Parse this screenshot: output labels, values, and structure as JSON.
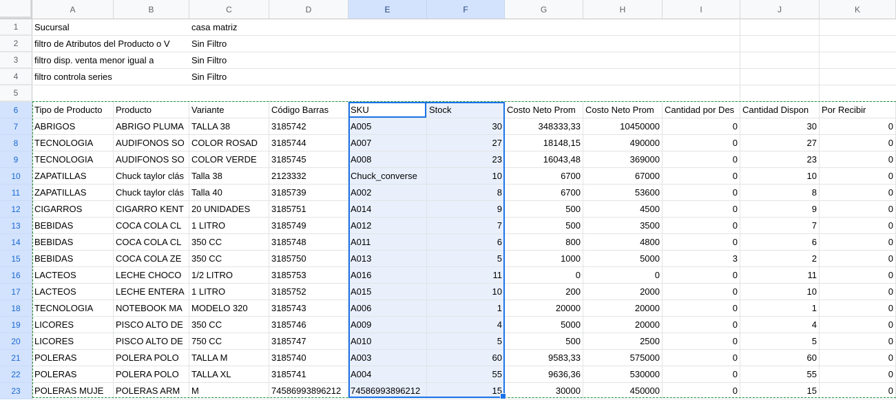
{
  "sheet": {
    "column_headers": [
      "A",
      "B",
      "C",
      "D",
      "E",
      "F",
      "G",
      "H",
      "I",
      "J",
      "K"
    ],
    "selected_columns": [
      "E",
      "F"
    ],
    "selection": {
      "range": "E6:F23",
      "active_cell": "E6"
    },
    "report_rows": [
      {
        "n": "1",
        "a": "Sucursal",
        "c": "casa matriz"
      },
      {
        "n": "2",
        "a": "filtro de Atributos del Producto o V",
        "c": "Sin Filtro"
      },
      {
        "n": "3",
        "a": "filtro disp. venta menor igual a",
        "c": "Sin Filtro"
      },
      {
        "n": "4",
        "a": "filtro controla series",
        "c": "Sin Filtro"
      },
      {
        "n": "5",
        "a": "",
        "c": ""
      }
    ],
    "table": {
      "header_row_number": "6",
      "headers": [
        "Tipo de Producto",
        "Producto",
        "Variante",
        "Código Barras",
        "SKU",
        "Stock",
        "Costo Neto Prom",
        "Costo Neto Prom",
        "Cantidad por Des",
        "Cantidad Dispon",
        "Por Recibir"
      ],
      "rows": [
        {
          "n": "7",
          "cells": [
            "ABRIGOS",
            "ABRIGO PLUMA",
            "TALLA 38",
            "3185742",
            "A005",
            "30",
            "348333,33",
            "10450000",
            "0",
            "30",
            "0"
          ]
        },
        {
          "n": "8",
          "cells": [
            "TECNOLOGIA",
            "AUDIFONOS SO",
            "COLOR ROSAD",
            "3185744",
            "A007",
            "27",
            "18148,15",
            "490000",
            "0",
            "27",
            "0"
          ]
        },
        {
          "n": "9",
          "cells": [
            "TECNOLOGIA",
            "AUDIFONOS SO",
            "COLOR VERDE",
            "3185745",
            "A008",
            "23",
            "16043,48",
            "369000",
            "0",
            "23",
            "0"
          ]
        },
        {
          "n": "10",
          "cells": [
            "ZAPATILLAS",
            "Chuck taylor clás",
            "Talla 38",
            "2123332",
            "Chuck_converse",
            "10",
            "6700",
            "67000",
            "0",
            "10",
            "0"
          ]
        },
        {
          "n": "11",
          "cells": [
            "ZAPATILLAS",
            "Chuck taylor clás",
            "Talla 40",
            "3185739",
            "A002",
            "8",
            "6700",
            "53600",
            "0",
            "8",
            "0"
          ]
        },
        {
          "n": "12",
          "cells": [
            "CIGARROS",
            "CIGARRO KENT",
            "20 UNIDADES",
            "3185751",
            "A014",
            "9",
            "500",
            "4500",
            "0",
            "9",
            "0"
          ]
        },
        {
          "n": "13",
          "cells": [
            "BEBIDAS",
            "COCA COLA CL",
            "1 LITRO",
            "3185749",
            "A012",
            "7",
            "500",
            "3500",
            "0",
            "7",
            "0"
          ]
        },
        {
          "n": "14",
          "cells": [
            "BEBIDAS",
            "COCA COLA CL",
            "350 CC",
            "3185748",
            "A011",
            "6",
            "800",
            "4800",
            "0",
            "6",
            "0"
          ]
        },
        {
          "n": "15",
          "cells": [
            "BEBIDAS",
            "COCA COLA ZE",
            "350 CC",
            "3185750",
            "A013",
            "5",
            "1000",
            "5000",
            "3",
            "2",
            "0"
          ]
        },
        {
          "n": "16",
          "cells": [
            "LACTEOS",
            "LECHE CHOCO",
            "1/2 LITRO",
            "3185753",
            "A016",
            "11",
            "0",
            "0",
            "0",
            "11",
            "0"
          ]
        },
        {
          "n": "17",
          "cells": [
            "LACTEOS",
            "LECHE ENTERA",
            "1 LITRO",
            "3185752",
            "A015",
            "10",
            "200",
            "2000",
            "0",
            "10",
            "0"
          ]
        },
        {
          "n": "18",
          "cells": [
            "TECNOLOGIA",
            "NOTEBOOK MA",
            "MODELO 320",
            "3185743",
            "A006",
            "1",
            "20000",
            "20000",
            "0",
            "1",
            "0"
          ]
        },
        {
          "n": "19",
          "cells": [
            "LICORES",
            "PISCO ALTO DE",
            "350 CC",
            "3185746",
            "A009",
            "4",
            "5000",
            "20000",
            "0",
            "4",
            "0"
          ]
        },
        {
          "n": "20",
          "cells": [
            "LICORES",
            "PISCO ALTO DE",
            "750 CC",
            "3185747",
            "A010",
            "5",
            "500",
            "2500",
            "0",
            "5",
            "0"
          ]
        },
        {
          "n": "21",
          "cells": [
            "POLERAS",
            "POLERA POLO",
            "TALLA M",
            "3185740",
            "A003",
            "60",
            "9583,33",
            "575000",
            "0",
            "60",
            "0"
          ]
        },
        {
          "n": "22",
          "cells": [
            "POLERAS",
            "POLERA POLO",
            "TALLA XL",
            "3185741",
            "A004",
            "55",
            "9636,36",
            "530000",
            "0",
            "55",
            "0"
          ]
        },
        {
          "n": "23",
          "cells": [
            "POLERAS MUJE",
            "POLERAS ARM",
            "M",
            "74586993896212",
            "74586993896212",
            "15",
            "30000",
            "450000",
            "0",
            "15",
            "0"
          ]
        }
      ]
    },
    "colors": {
      "accent_blue": "#1a73e8",
      "selection_tint": "#e9f0fc",
      "selected_header_bg": "#d3e3fd",
      "selected_header_text": "#20427a",
      "selected_row_number_text": "#1967d2",
      "marquee_green": "#1e8e3e",
      "gridline": "#e2e3e3",
      "header_bg": "#f8f9fa",
      "header_text": "#5f6368"
    }
  }
}
